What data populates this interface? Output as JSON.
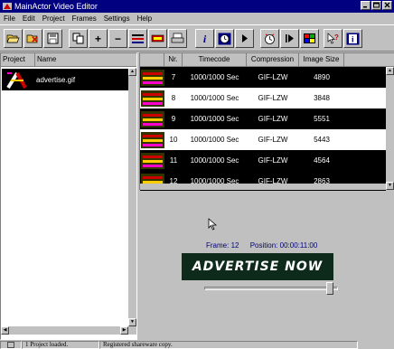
{
  "window": {
    "title": "MainActor Video Editor"
  },
  "menu": [
    "File",
    "Edit",
    "Project",
    "Frames",
    "Settings",
    "Help"
  ],
  "toolbar": {
    "buttons": [
      {
        "name": "open-icon",
        "glyph": "📂"
      },
      {
        "name": "close-file-icon",
        "glyph": "✖"
      },
      {
        "name": "save-icon",
        "glyph": "▣"
      },
      {
        "name": "copy-icon",
        "glyph": "⧉"
      },
      {
        "name": "add-icon",
        "glyph": "+"
      },
      {
        "name": "remove-icon",
        "glyph": "−"
      },
      {
        "name": "insert-frames-icon",
        "glyph": "≡"
      },
      {
        "name": "append-frames-icon",
        "glyph": "≣"
      },
      {
        "name": "print-icon",
        "glyph": "⎙"
      },
      {
        "name": "info-icon",
        "glyph": "i"
      },
      {
        "name": "timer-icon",
        "glyph": "◷"
      },
      {
        "name": "play-icon",
        "glyph": "▶"
      },
      {
        "name": "clock-icon",
        "glyph": "◔"
      },
      {
        "name": "step-play-icon",
        "glyph": "⏵"
      },
      {
        "name": "palette-icon",
        "glyph": "■"
      },
      {
        "name": "help-pointer-icon",
        "glyph": "?"
      },
      {
        "name": "about-icon",
        "glyph": "i"
      }
    ]
  },
  "project_list": {
    "headers": [
      "Project",
      "Name"
    ],
    "items": [
      {
        "name": "advertise.gif"
      }
    ]
  },
  "frames_table": {
    "headers": [
      "Nr.",
      "Timecode",
      "Compression",
      "Image Size"
    ],
    "rows": [
      {
        "nr": "7",
        "timecode": "1000/1000 Sec",
        "compression": "GIF-LZW",
        "size": "4890"
      },
      {
        "nr": "8",
        "timecode": "1000/1000 Sec",
        "compression": "GIF-LZW",
        "size": "3848"
      },
      {
        "nr": "9",
        "timecode": "1000/1000 Sec",
        "compression": "GIF-LZW",
        "size": "5551"
      },
      {
        "nr": "10",
        "timecode": "1000/1000 Sec",
        "compression": "GIF-LZW",
        "size": "5443"
      },
      {
        "nr": "11",
        "timecode": "1000/1000 Sec",
        "compression": "GIF-LZW",
        "size": "4564"
      },
      {
        "nr": "12",
        "timecode": "1000/1000 Sec",
        "compression": "GIF-LZW",
        "size": "2863"
      }
    ]
  },
  "preview": {
    "frame_label": "Frame:",
    "frame_value": "12",
    "position_label": "Position:",
    "position_value": "00:00:11:00",
    "banner_text": "ADVERTISE NOW",
    "slider_position": 0.92
  },
  "status": {
    "cells": [
      "1 Project loaded.",
      "Registered shareware copy."
    ]
  },
  "colors": {
    "titlebar": "#000080",
    "selection": "#000000",
    "banner_bg": "#0d2a1a"
  }
}
